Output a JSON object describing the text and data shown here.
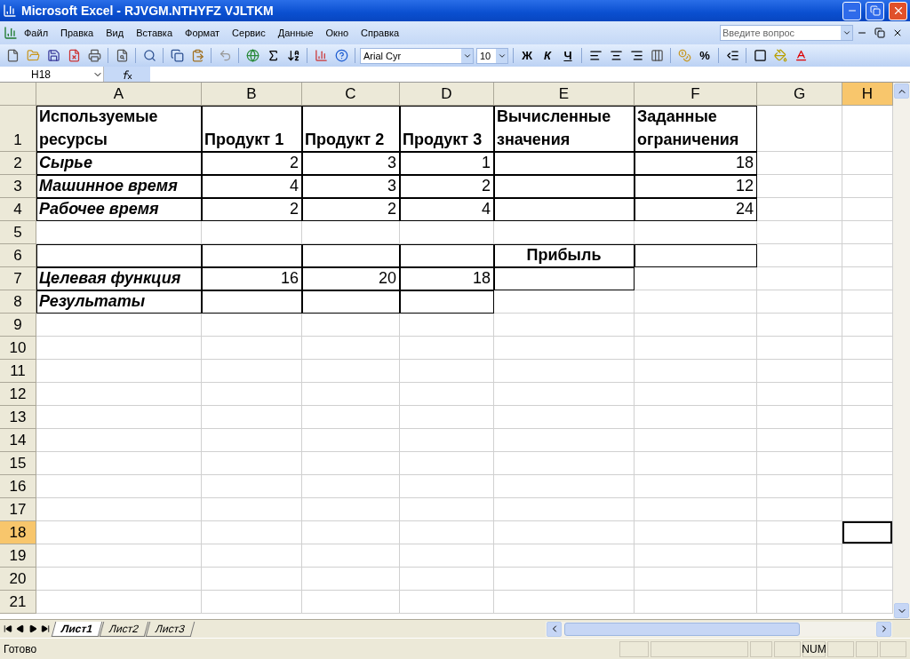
{
  "window": {
    "title": "Microsoft Excel - RJVGM.NTHYFZ VJLTKM"
  },
  "menu": [
    "Файл",
    "Правка",
    "Вид",
    "Вставка",
    "Формат",
    "Сервис",
    "Данные",
    "Окно",
    "Справка"
  ],
  "help_search": {
    "placeholder": "Введите вопрос"
  },
  "format_toolbar": {
    "font": "Arial Cyr",
    "size": "10",
    "bold": "Ж",
    "italic": "К",
    "underline": "Ч",
    "percent": "%"
  },
  "name_box": "H18",
  "columns": [
    {
      "label": "A",
      "selected": false
    },
    {
      "label": "B",
      "selected": false
    },
    {
      "label": "C",
      "selected": false
    },
    {
      "label": "D",
      "selected": false
    },
    {
      "label": "E",
      "selected": false
    },
    {
      "label": "F",
      "selected": false
    },
    {
      "label": "G",
      "selected": false
    },
    {
      "label": "H",
      "selected": true
    }
  ],
  "rows": [
    {
      "header": "1",
      "selected": false,
      "cells": [
        {
          "text": "Используемые ресурсы",
          "kind": "heading",
          "bordered": true,
          "selected": false
        },
        {
          "text": "Продукт 1",
          "kind": "heading",
          "bordered": true,
          "selected": false
        },
        {
          "text": "Продукт 2",
          "kind": "heading",
          "bordered": true,
          "selected": false
        },
        {
          "text": "Продукт 3",
          "kind": "heading",
          "bordered": true,
          "selected": false
        },
        {
          "text": "Вычисленные значения",
          "kind": "heading",
          "bordered": true,
          "selected": false
        },
        {
          "text": "Заданные ограничения",
          "kind": "heading",
          "bordered": true,
          "selected": false
        },
        {
          "bordered": false,
          "selected": false
        },
        {
          "bordered": false,
          "selected": false
        }
      ]
    },
    {
      "header": "2",
      "selected": false,
      "cells": [
        {
          "text": "Сырье",
          "kind": "label",
          "bordered": true,
          "selected": false
        },
        {
          "text": "2",
          "kind": "number",
          "bordered": true,
          "selected": false
        },
        {
          "text": "3",
          "kind": "number",
          "bordered": true,
          "selected": false
        },
        {
          "text": "1",
          "kind": "number",
          "bordered": true,
          "selected": false
        },
        {
          "bordered": true,
          "selected": false
        },
        {
          "text": "18",
          "kind": "number",
          "bordered": true,
          "selected": false
        },
        {
          "bordered": false,
          "selected": false
        },
        {
          "bordered": false,
          "selected": false
        }
      ]
    },
    {
      "header": "3",
      "selected": false,
      "cells": [
        {
          "text": "Машинное время",
          "kind": "label",
          "bordered": true,
          "selected": false
        },
        {
          "text": "4",
          "kind": "number",
          "bordered": true,
          "selected": false
        },
        {
          "text": "3",
          "kind": "number",
          "bordered": true,
          "selected": false
        },
        {
          "text": "2",
          "kind": "number",
          "bordered": true,
          "selected": false
        },
        {
          "bordered": true,
          "selected": false
        },
        {
          "text": "12",
          "kind": "number",
          "bordered": true,
          "selected": false
        },
        {
          "bordered": false,
          "selected": false
        },
        {
          "bordered": false,
          "selected": false
        }
      ]
    },
    {
      "header": "4",
      "selected": false,
      "cells": [
        {
          "text": "Рабочее время",
          "kind": "label",
          "bordered": true,
          "selected": false
        },
        {
          "text": "2",
          "kind": "number",
          "bordered": true,
          "selected": false
        },
        {
          "text": "2",
          "kind": "number",
          "bordered": true,
          "selected": false
        },
        {
          "text": "4",
          "kind": "number",
          "bordered": true,
          "selected": false
        },
        {
          "bordered": true,
          "selected": false
        },
        {
          "text": "24",
          "kind": "number",
          "bordered": true,
          "selected": false
        },
        {
          "bordered": false,
          "selected": false
        },
        {
          "bordered": false,
          "selected": false
        }
      ]
    },
    {
      "header": "5",
      "selected": false,
      "cells": [
        {
          "bordered": false,
          "selected": false
        },
        {
          "bordered": false,
          "selected": false
        },
        {
          "bordered": false,
          "selected": false
        },
        {
          "bordered": false,
          "selected": false
        },
        {
          "bordered": false,
          "selected": false
        },
        {
          "bordered": false,
          "selected": false
        },
        {
          "bordered": false,
          "selected": false
        },
        {
          "bordered": false,
          "selected": false
        }
      ]
    },
    {
      "header": "6",
      "selected": false,
      "cells": [
        {
          "bordered": true,
          "selected": false
        },
        {
          "bordered": true,
          "selected": false
        },
        {
          "bordered": true,
          "selected": false
        },
        {
          "bordered": true,
          "selected": false
        },
        {
          "text": "Прибыль",
          "kind": "title",
          "bordered": true,
          "selected": false
        },
        {
          "bordered": true,
          "selected": false
        },
        {
          "bordered": false,
          "selected": false
        },
        {
          "bordered": false,
          "selected": false
        }
      ]
    },
    {
      "header": "7",
      "selected": false,
      "cells": [
        {
          "text": "Целевая функция",
          "kind": "label",
          "bordered": true,
          "selected": false
        },
        {
          "text": "16",
          "kind": "number",
          "bordered": true,
          "selected": false
        },
        {
          "text": "20",
          "kind": "number",
          "bordered": true,
          "selected": false
        },
        {
          "text": "18",
          "kind": "number",
          "bordered": true,
          "selected": false
        },
        {
          "bordered": true,
          "selected": false
        },
        {
          "bordered": false,
          "selected": false
        },
        {
          "bordered": false,
          "selected": false
        },
        {
          "bordered": false,
          "selected": false
        }
      ]
    },
    {
      "header": "8",
      "selected": false,
      "cells": [
        {
          "text": "Результаты",
          "kind": "label",
          "bordered": true,
          "selected": false
        },
        {
          "bordered": true,
          "selected": false
        },
        {
          "bordered": true,
          "selected": false
        },
        {
          "bordered": true,
          "selected": false
        },
        {
          "bordered": false,
          "selected": false
        },
        {
          "bordered": false,
          "selected": false
        },
        {
          "bordered": false,
          "selected": false
        },
        {
          "bordered": false,
          "selected": false
        }
      ]
    },
    {
      "header": "9",
      "selected": false,
      "cells": []
    },
    {
      "header": "10",
      "selected": false,
      "cells": []
    },
    {
      "header": "11",
      "selected": false,
      "cells": []
    },
    {
      "header": "12",
      "selected": false,
      "cells": []
    },
    {
      "header": "13",
      "selected": false,
      "cells": []
    },
    {
      "header": "14",
      "selected": false,
      "cells": []
    },
    {
      "header": "15",
      "selected": false,
      "cells": []
    },
    {
      "header": "16",
      "selected": false,
      "cells": []
    },
    {
      "header": "17",
      "selected": false,
      "cells": []
    },
    {
      "header": "18",
      "selected": true,
      "cells": [
        {
          "bordered": false,
          "selected": false
        },
        {
          "bordered": false,
          "selected": false
        },
        {
          "bordered": false,
          "selected": false
        },
        {
          "bordered": false,
          "selected": false
        },
        {
          "bordered": false,
          "selected": false
        },
        {
          "bordered": false,
          "selected": false
        },
        {
          "bordered": false,
          "selected": false
        },
        {
          "bordered": false,
          "selected": true
        }
      ]
    },
    {
      "header": "19",
      "selected": false,
      "cells": []
    },
    {
      "header": "20",
      "selected": false,
      "cells": []
    },
    {
      "header": "21",
      "selected": false,
      "cells": []
    }
  ],
  "sheet_tabs": [
    {
      "label": "Лист1",
      "selected": true
    },
    {
      "label": "Лист2",
      "selected": false
    },
    {
      "label": "Лист3",
      "selected": false
    }
  ],
  "status_bar": {
    "text": "Готово",
    "indicator": "NUM"
  }
}
